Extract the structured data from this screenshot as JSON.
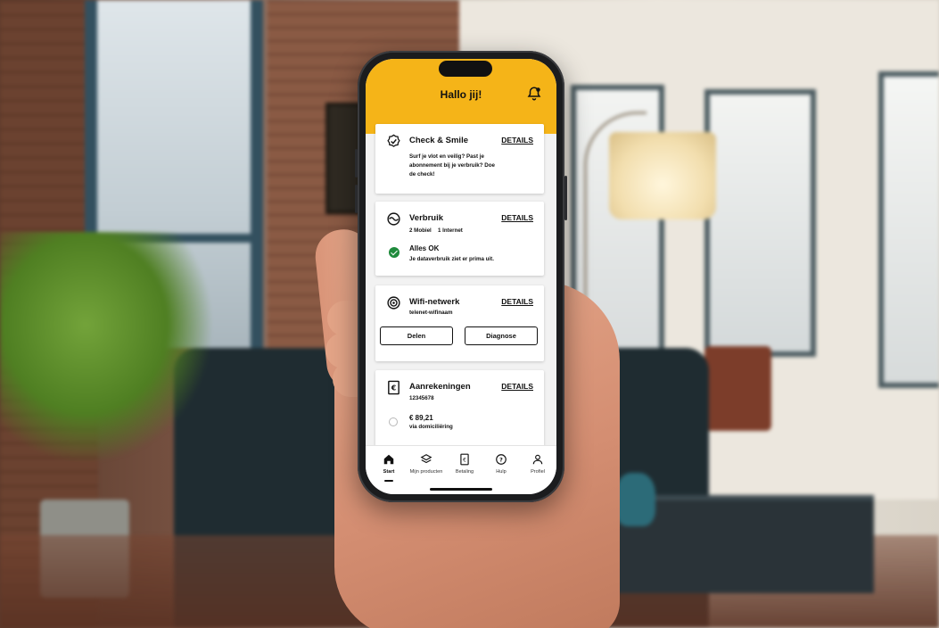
{
  "app": {
    "greeting": "Hallo jij!"
  },
  "cards": {
    "check_smile": {
      "title": "Check & Smile",
      "details_label": "DETAILS",
      "line1": "Surf je vlot en veilig? Past je",
      "line2": "abonnement bij je verbruik? Doe",
      "line3": "de check!"
    },
    "verbruik": {
      "title": "Verbruik",
      "details_label": "DETAILS",
      "mobile": "2 Mobiel",
      "internet": "1 Internet",
      "status_title": "Alles OK",
      "status_text": "Je dataverbruik ziet er prima uit."
    },
    "wifi": {
      "title": "Wifi-netwerk",
      "details_label": "DETAILS",
      "network_name": "telenet-wifinaam",
      "share_label": "Delen",
      "diagnose_label": "Diagnose"
    },
    "billing": {
      "title": "Aanrekeningen",
      "details_label": "DETAILS",
      "account_number": "12345678",
      "amount": "€ 89,21",
      "method": "via domiciliëring"
    }
  },
  "nav": {
    "start": "Start",
    "products": "Mijn producten",
    "payment": "Betaling",
    "help": "Hulp",
    "profile": "Profiel"
  },
  "colors": {
    "brand_yellow": "#f5b418",
    "ok_green": "#1f8a3c"
  }
}
